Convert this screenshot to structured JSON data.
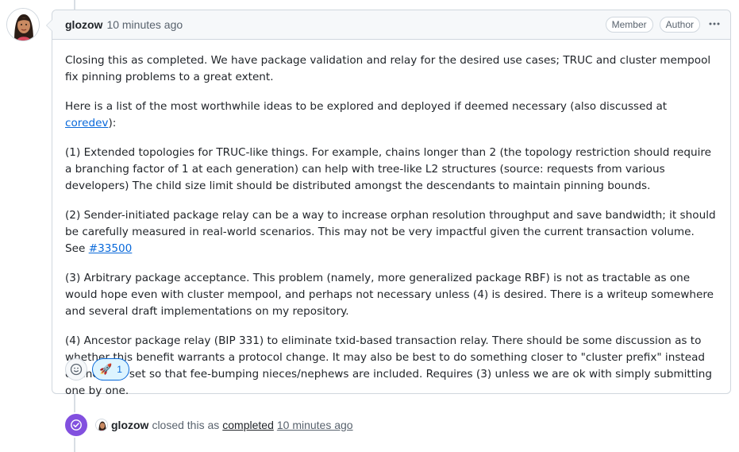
{
  "comment": {
    "author": "glozow",
    "timestamp": "10 minutes ago",
    "badges": [
      "Member",
      "Author"
    ],
    "menu_icon": "kebab-horizontal-icon",
    "body": {
      "p1": "Closing this as completed. We have package validation and relay for the desired use cases; TRUC and cluster mempool fix pinning problems to a great extent.",
      "p2_prefix": "Here is a list of the most worthwhile ideas to be explored and deployed if deemed necessary (also discussed at ",
      "p2_link": "coredev",
      "p2_suffix": "):",
      "p3": "(1) Extended topologies for TRUC-like things. For example, chains longer than 2 (the topology restriction should require a branching factor of 1 at each generation) can help with tree-like L2 structures (source: requests from various developers) The child size limit should be distributed amongst the descendants to maintain pinning bounds.",
      "p4_prefix": "(2) Sender-initiated package relay can be a way to increase orphan resolution throughput and save bandwidth; it should be carefully measured in real-world scenarios. This may not be very impactful given the current transaction volume. See ",
      "p4_link": "#33500",
      "p5": "(3) Arbitrary package acceptance. This problem (namely, more generalized package RBF) is not as tractable as one would hope even with cluster mempool, and perhaps not necessary unless (4) is desired. There is a writeup somewhere and several draft implementations on my repository.",
      "p6": "(4) Ancestor package relay (BIP 331) to eliminate txid-based transaction relay. There should be some discussion as to whether this benefit warrants a protocol change. It may also be best to do something closer to \"cluster prefix\" instead of ancestor set so that fee-bumping nieces/nephews are included. Requires (3) unless we are ok with simply submitting one by one."
    },
    "reactions": {
      "add_icon": "smiley-icon",
      "rocket_glyph": "🚀",
      "rocket_count": "1"
    }
  },
  "event": {
    "icon": "check-circle-icon",
    "author": "glozow",
    "action": "closed this as",
    "status": "completed",
    "time": "10 minutes ago"
  },
  "colors": {
    "accent": "#0969da",
    "closed_purple": "#8250df",
    "border": "#d0d7de",
    "header_bg": "#f6f8fa"
  }
}
